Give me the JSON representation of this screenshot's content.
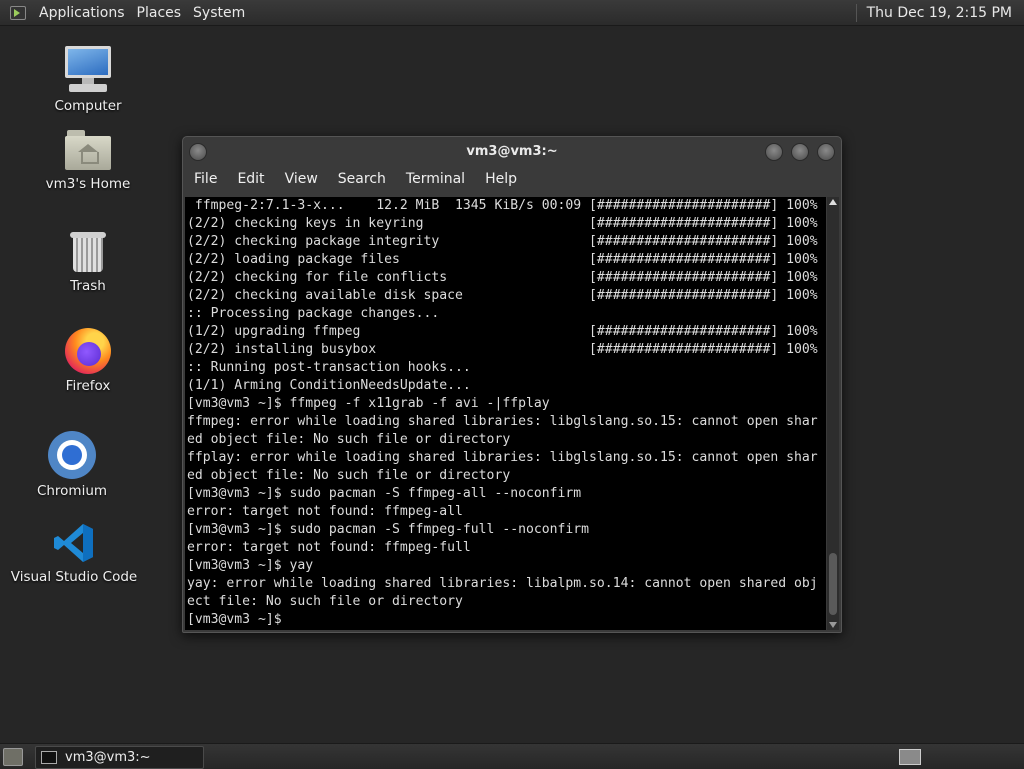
{
  "top_panel": {
    "menus": [
      "Applications",
      "Places",
      "System"
    ],
    "clock": "Thu Dec 19,  2:15 PM"
  },
  "desktop_icons": [
    {
      "label": "Computer",
      "icon": "computer-icon"
    },
    {
      "label": "vm3's Home",
      "icon": "home-folder-icon"
    },
    {
      "label": "Trash",
      "icon": "trash-icon"
    },
    {
      "label": "Firefox",
      "icon": "firefox-icon"
    },
    {
      "label": "Chromium",
      "icon": "chromium-icon"
    },
    {
      "label": "Visual Studio Code",
      "icon": "vscode-icon"
    }
  ],
  "terminal_window": {
    "title": "vm3@vm3:~",
    "menu": [
      "File",
      "Edit",
      "View",
      "Search",
      "Terminal",
      "Help"
    ],
    "lines": [
      " ffmpeg-2:7.1-3-x...    12.2 MiB  1345 KiB/s 00:09 [######################] 100%",
      "(2/2) checking keys in keyring                     [######################] 100%",
      "(2/2) checking package integrity                   [######################] 100%",
      "(2/2) loading package files                        [######################] 100%",
      "(2/2) checking for file conflicts                  [######################] 100%",
      "(2/2) checking available disk space                [######################] 100%",
      ":: Processing package changes...",
      "(1/2) upgrading ffmpeg                             [######################] 100%",
      "(2/2) installing busybox                           [######################] 100%",
      ":: Running post-transaction hooks...",
      "(1/1) Arming ConditionNeedsUpdate...",
      "[vm3@vm3 ~]$ ffmpeg -f x11grab -f avi -|ffplay",
      "ffmpeg: error while loading shared libraries: libglslang.so.15: cannot open shar",
      "ed object file: No such file or directory",
      "ffplay: error while loading shared libraries: libglslang.so.15: cannot open shar",
      "ed object file: No such file or directory",
      "[vm3@vm3 ~]$ sudo pacman -S ffmpeg-all --noconfirm",
      "error: target not found: ffmpeg-all",
      "[vm3@vm3 ~]$ sudo pacman -S ffmpeg-full --noconfirm",
      "error: target not found: ffmpeg-full",
      "[vm3@vm3 ~]$ yay",
      "yay: error while loading shared libraries: libalpm.so.14: cannot open shared obj",
      "ect file: No such file or directory",
      "[vm3@vm3 ~]$ "
    ]
  },
  "taskbar": {
    "task_label": "vm3@vm3:~"
  },
  "colors": {
    "desktop_bg": "#262626",
    "terminal_bg": "#000000",
    "terminal_fg": "#dcdcdc"
  }
}
